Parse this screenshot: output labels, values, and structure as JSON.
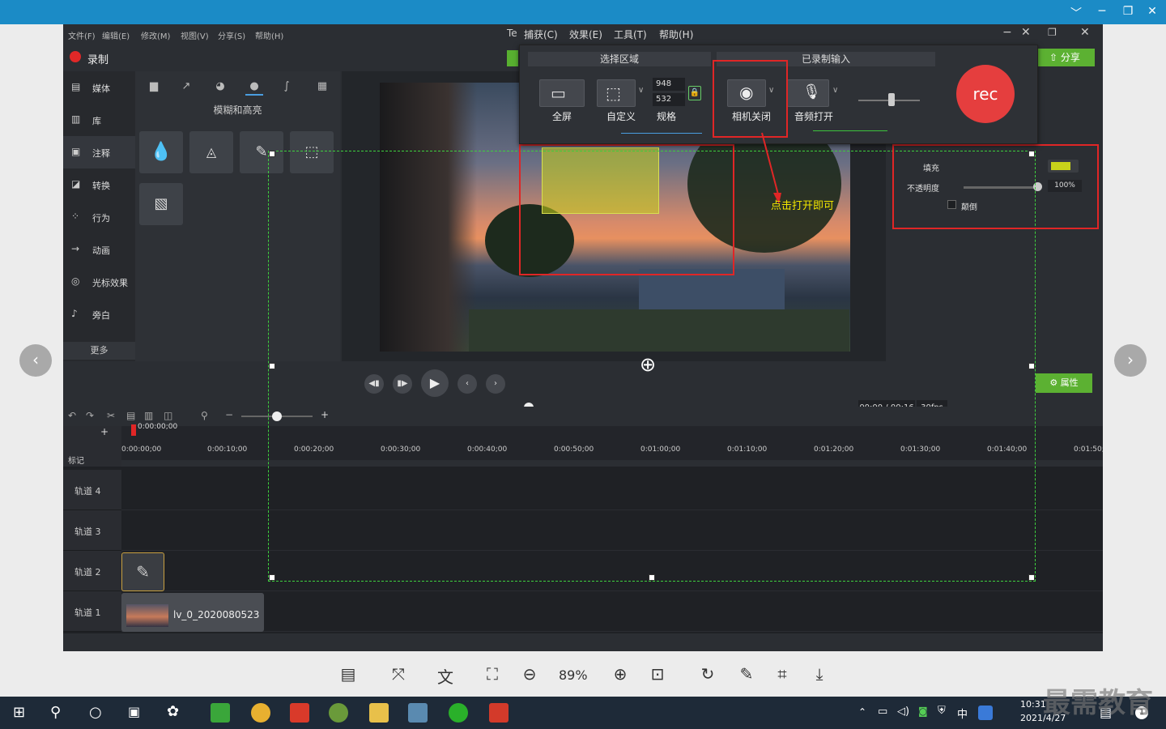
{
  "viewer": {
    "min": "﹀",
    "minimize": "─",
    "restore": "❐",
    "close": "✕"
  },
  "menu": [
    "文件(F)",
    "编辑(E)",
    "修改(M)",
    "视图(V)",
    "分享(S)",
    "帮助(H)"
  ],
  "top_menu": {
    "te": "Te",
    "items": [
      "捕获(C)",
      "效果(E)",
      "工具(T)",
      "帮助(H)"
    ]
  },
  "record_label": "录制",
  "share_label": "分享",
  "sidebar": [
    {
      "label": "媒体",
      "icon": "film-icon"
    },
    {
      "label": "库",
      "icon": "library-icon"
    },
    {
      "label": "注释",
      "icon": "annotation-icon"
    },
    {
      "label": "转换",
      "icon": "transition-icon"
    },
    {
      "label": "行为",
      "icon": "behavior-icon"
    },
    {
      "label": "动画",
      "icon": "animation-icon"
    },
    {
      "label": "光标效果",
      "icon": "cursor-icon"
    },
    {
      "label": "旁白",
      "icon": "mic-icon"
    }
  ],
  "sidebar_more": "更多",
  "tools_title": "模糊和高亮",
  "rec_toolbar": {
    "select_area": "选择区域",
    "full_screen": "全屏",
    "custom": "自定义",
    "width": "948",
    "height": "532",
    "spec": "规格",
    "recorded_input": "已录制输入",
    "camera_off": "相机关闭",
    "audio_on": "音频打开",
    "rec": "rec"
  },
  "annotation": "点击打开即可",
  "props": {
    "fill": "填充",
    "opacity": "不透明度",
    "opacity_value": "100%",
    "invert": "颠倒",
    "fill_color": "#c8d31a"
  },
  "playback": {
    "time": "00:00 / 00:16",
    "fps": "30fps",
    "properties": "属性"
  },
  "timeline": {
    "playhead": "0:00:00;00",
    "marker": "标记",
    "ticks": [
      "0:00:00;00",
      "0:00:10;00",
      "0:00:20;00",
      "0:00:30;00",
      "0:00:40;00",
      "0:00:50;00",
      "0:01:00;00",
      "0:01:10;00",
      "0:01:20;00",
      "0:01:30;00",
      "0:01:40;00",
      "0:01:50;0"
    ]
  },
  "tracks": [
    "轨道 4",
    "轨道 3",
    "轨道 2",
    "轨道 1"
  ],
  "clip_name": "lv_0_2020080523",
  "zoom": "89%",
  "clock": {
    "time": "10:31",
    "date": "2021/4/27"
  },
  "ime": "中",
  "watermark": "最需教育",
  "notif_count": "1"
}
